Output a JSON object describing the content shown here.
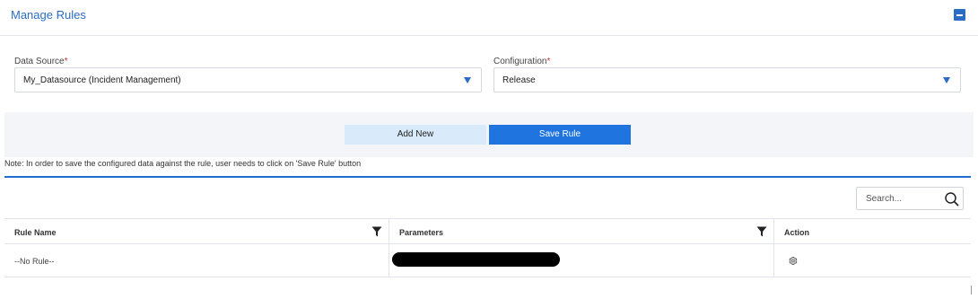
{
  "header": {
    "title": "Manage Rules",
    "collapse_icon": "minus-square-icon"
  },
  "form": {
    "data_source": {
      "label": "Data Source",
      "required_mark": "*",
      "value": "My_Datasource (Incident Management)"
    },
    "configuration": {
      "label": "Configuration",
      "required_mark": "*",
      "value": "Release"
    }
  },
  "actions": {
    "add_new": "Add New",
    "save_rule": "Save Rule"
  },
  "note": "Note: In order to save the configured data against the rule, user needs to click on 'Save Rule' button",
  "search": {
    "placeholder": "Search..."
  },
  "table": {
    "columns": [
      "Rule Name",
      "Parameters",
      "Action"
    ],
    "rows": [
      {
        "rule_name": "--No Rule--",
        "parameters": "",
        "action_icon": "gear-icon"
      }
    ]
  },
  "colors": {
    "accent": "#1f74e0",
    "title": "#2b6cc4",
    "required": "#d0312d",
    "light_button": "#d9eafa"
  }
}
